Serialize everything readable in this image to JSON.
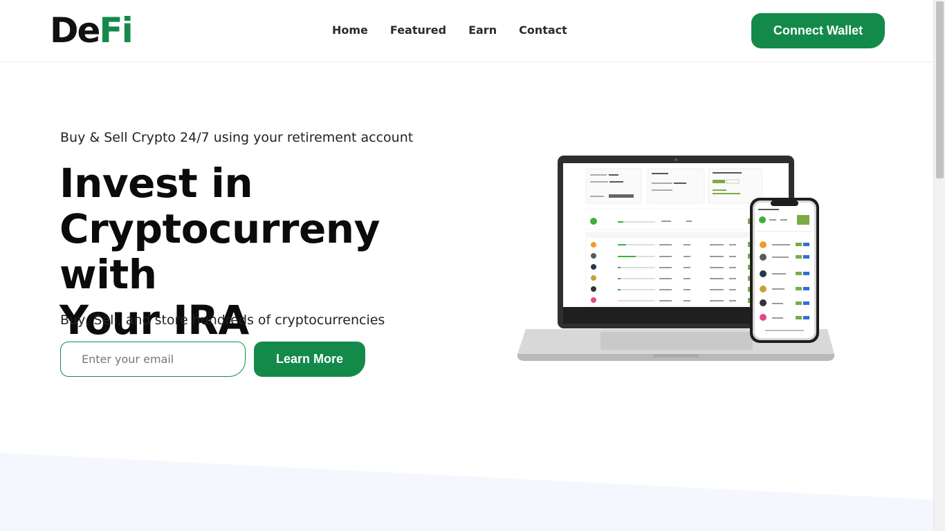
{
  "brand": {
    "logo_part1": "De",
    "logo_part2": "Fi",
    "accent_color": "#138a4a"
  },
  "nav": {
    "items": [
      "Home",
      "Featured",
      "Earn",
      "Contact"
    ]
  },
  "header": {
    "connect_label": "Connect Wallet"
  },
  "hero": {
    "eyebrow": "Buy & Sell Crypto 24/7 using your retirement account",
    "headline_line1": "Invest in",
    "headline_line2": "Cryptocurreny with",
    "headline_line3": "Your IRA",
    "subline": "Buy, Sell, and store hundreds of cryptocurrencies",
    "email_placeholder": "Enter your email",
    "cta_label": "Learn More"
  },
  "illustration": {
    "icon": "laptop-and-phone-dashboard"
  }
}
